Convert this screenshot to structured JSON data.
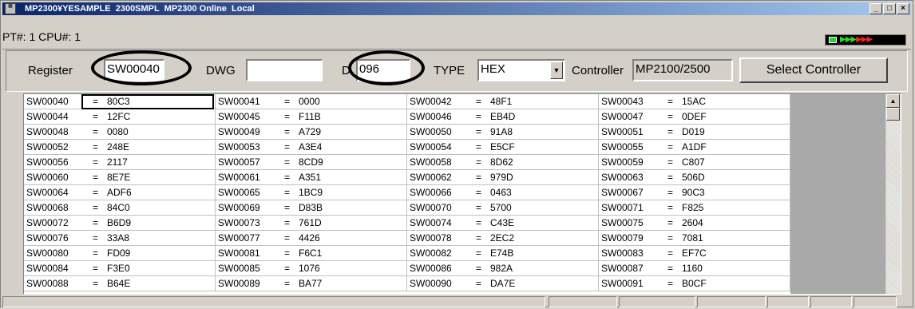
{
  "window": {
    "title": "MP2300¥YESAMPLE  2300SMPL  MP2300 Online  Local",
    "minimize": "_",
    "maximize": "□",
    "close": "×",
    "app_icon": "app-logo-icon"
  },
  "info": {
    "text": "PT#: 1 CPU#: 1",
    "indicator_icon": "online-status-icon"
  },
  "controls": {
    "register_label": "Register",
    "register_value": "SW00040",
    "dwg_label": "DWG",
    "dwg_value": "",
    "d_label": "D",
    "d_value": "096",
    "type_label": "TYPE",
    "type_value": "HEX",
    "controller_label": "Controller",
    "controller_value": "MP2100/2500",
    "select_controller_label": "Select Controller"
  },
  "grid": {
    "rows": [
      [
        [
          "SW00040",
          "80C3"
        ],
        [
          "SW00041",
          "0000"
        ],
        [
          "SW00042",
          "48F1"
        ],
        [
          "SW00043",
          "15AC"
        ]
      ],
      [
        [
          "SW00044",
          "12FC"
        ],
        [
          "SW00045",
          "F11B"
        ],
        [
          "SW00046",
          "EB4D"
        ],
        [
          "SW00047",
          "0DEF"
        ]
      ],
      [
        [
          "SW00048",
          "0080"
        ],
        [
          "SW00049",
          "A729"
        ],
        [
          "SW00050",
          "91A8"
        ],
        [
          "SW00051",
          "D019"
        ]
      ],
      [
        [
          "SW00052",
          "248E"
        ],
        [
          "SW00053",
          "A3E4"
        ],
        [
          "SW00054",
          "E5CF"
        ],
        [
          "SW00055",
          "A1DF"
        ]
      ],
      [
        [
          "SW00056",
          "2117"
        ],
        [
          "SW00057",
          "8CD9"
        ],
        [
          "SW00058",
          "8D62"
        ],
        [
          "SW00059",
          "C807"
        ]
      ],
      [
        [
          "SW00060",
          "8E7E"
        ],
        [
          "SW00061",
          "A351"
        ],
        [
          "SW00062",
          "979D"
        ],
        [
          "SW00063",
          "506D"
        ]
      ],
      [
        [
          "SW00064",
          "ADF6"
        ],
        [
          "SW00065",
          "1BC9"
        ],
        [
          "SW00066",
          "0463"
        ],
        [
          "SW00067",
          "90C3"
        ]
      ],
      [
        [
          "SW00068",
          "84C0"
        ],
        [
          "SW00069",
          "D83B"
        ],
        [
          "SW00070",
          "5700"
        ],
        [
          "SW00071",
          "F825"
        ]
      ],
      [
        [
          "SW00072",
          "B6D9"
        ],
        [
          "SW00073",
          "761D"
        ],
        [
          "SW00074",
          "C43E"
        ],
        [
          "SW00075",
          "2604"
        ]
      ],
      [
        [
          "SW00076",
          "33A8"
        ],
        [
          "SW00077",
          "4426"
        ],
        [
          "SW00078",
          "2EC2"
        ],
        [
          "SW00079",
          "7081"
        ]
      ],
      [
        [
          "SW00080",
          "FD09"
        ],
        [
          "SW00081",
          "F6C1"
        ],
        [
          "SW00082",
          "E74B"
        ],
        [
          "SW00083",
          "EF7C"
        ]
      ],
      [
        [
          "SW00084",
          "F3E0"
        ],
        [
          "SW00085",
          "1076"
        ],
        [
          "SW00086",
          "982A"
        ],
        [
          "SW00087",
          "1160"
        ]
      ],
      [
        [
          "SW00088",
          "B64E"
        ],
        [
          "SW00089",
          "BA77"
        ],
        [
          "SW00090",
          "DA7E"
        ],
        [
          "SW00091",
          "B0CF"
        ]
      ]
    ],
    "equals": "="
  }
}
